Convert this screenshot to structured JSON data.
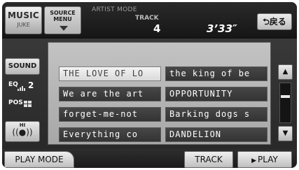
{
  "header": {
    "source": {
      "label": "MUSIC",
      "sub_label": "JUKE"
    },
    "source_menu": {
      "line1": "SOURCE",
      "line2": "MENU"
    },
    "mode_label": "ARTIST MODE",
    "track_label": "TRACK",
    "track_number": "4",
    "elapsed_time": "3’33″",
    "back_label": "⮌戻る"
  },
  "side": {
    "sound_label": "SOUND",
    "eq_label": "EQ",
    "eq_value": "2",
    "pos_label": "POS",
    "hi_label": "HI"
  },
  "songs": [
    {
      "title": "THE LOVE OF LO",
      "selected": true
    },
    {
      "title": "the king of be",
      "selected": false
    },
    {
      "title": "We are the art",
      "selected": false
    },
    {
      "title": "OPPORTUNITY",
      "selected": false
    },
    {
      "title": "forget-me-not",
      "selected": false
    },
    {
      "title": "Barking dogs s",
      "selected": false
    },
    {
      "title": "Everything co",
      "selected": false
    },
    {
      "title": "DANDELION",
      "selected": false
    }
  ],
  "scroll": {
    "up_icon": "up-triangle-icon",
    "down_icon": "down-triangle-icon",
    "position": 0.33
  },
  "footer": {
    "play_mode_label": "PLAY MODE",
    "track_label": "TRACK",
    "play_label": "PLAY"
  },
  "colors": {
    "background": "#2e2e2e",
    "list_panel": "#b8b8b8",
    "song_dark": "#3b3b3b",
    "song_selected": "#e8e8e8",
    "text_light": "#ffffff"
  }
}
